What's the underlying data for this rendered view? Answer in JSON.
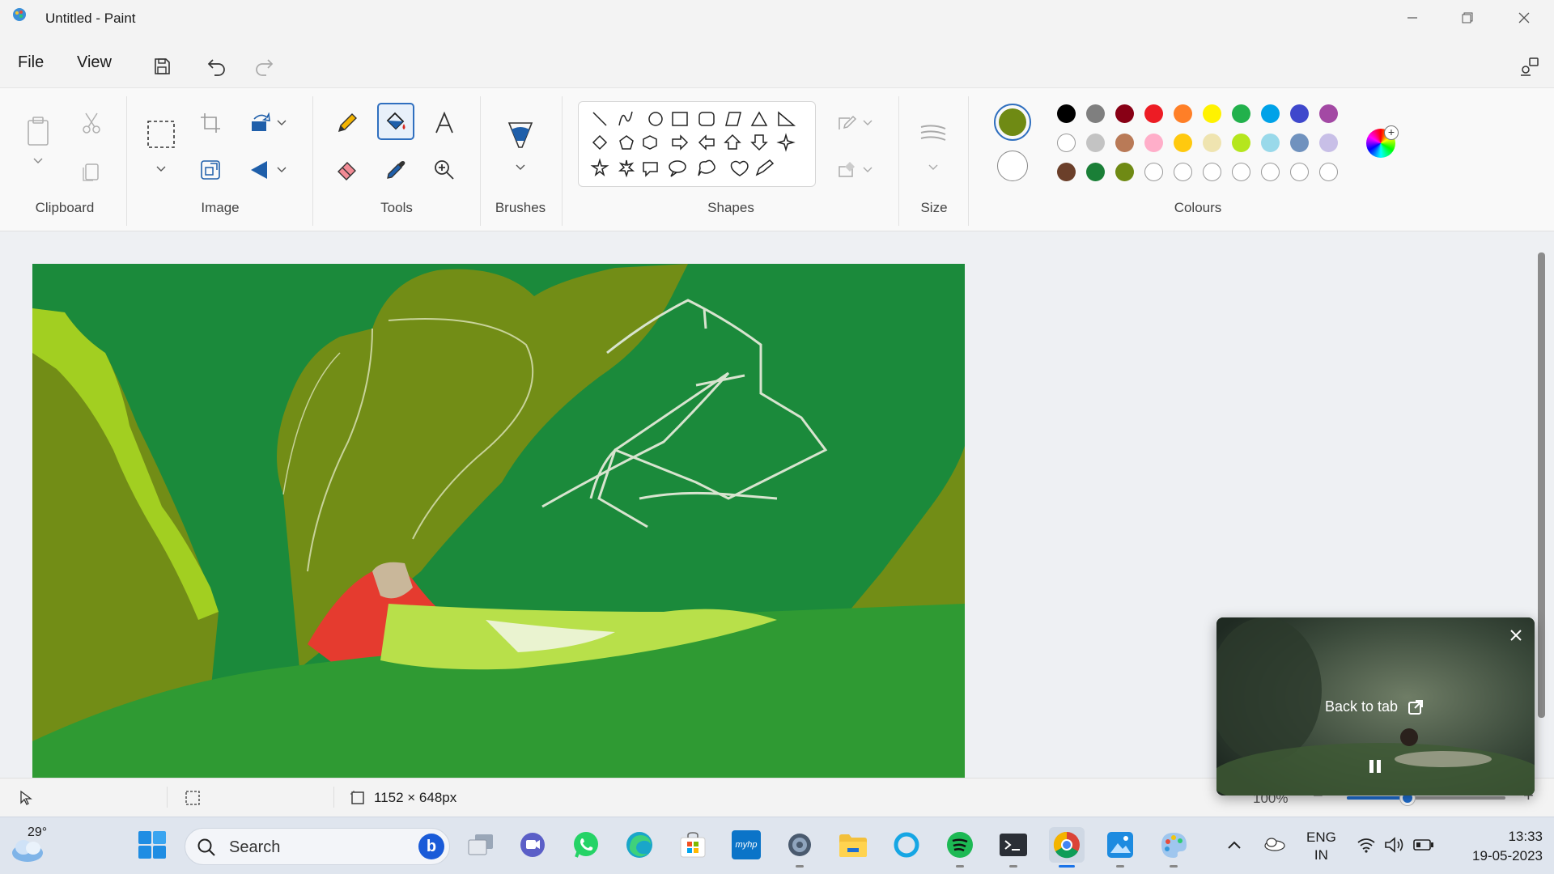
{
  "window": {
    "title": "Untitled - Paint"
  },
  "menu": {
    "file": "File",
    "view": "View"
  },
  "ribbon": {
    "groups": {
      "clipboard": "Clipboard",
      "image": "Image",
      "tools": "Tools",
      "brushes": "Brushes",
      "shapes": "Shapes",
      "size": "Size",
      "colours": "Colours"
    },
    "active_tool": "fill-tool",
    "primary_color": "#6f8a14",
    "secondary_color": "#ffffff",
    "palette": [
      [
        "#000000",
        "#7f7f7f",
        "#880015",
        "#ed1c24",
        "#ff7f27",
        "#fff200",
        "#22b14c",
        "#00a2e8",
        "#3f48cc",
        "#a349a4"
      ],
      [
        "#ffffff",
        "#c3c3c3",
        "#b97a57",
        "#ffaec9",
        "#ffc90e",
        "#efe4b0",
        "#b5e61d",
        "#99d9ea",
        "#7092be",
        "#c8bfe7"
      ],
      [
        "#6b3f2a",
        "#1a7f37",
        "#6f8a14",
        "",
        "",
        "",
        "",
        "",
        "",
        ""
      ]
    ]
  },
  "statusbar": {
    "canvas_size": "1152 × 648px",
    "zoom": "100%"
  },
  "pip": {
    "back_to_tab": "Back to tab"
  },
  "taskbar": {
    "weather_temp": "29°",
    "search_placeholder": "Search",
    "language": "ENG",
    "region": "IN",
    "time": "13:33",
    "date": "19-05-2023",
    "myhp_label": "myhp"
  }
}
